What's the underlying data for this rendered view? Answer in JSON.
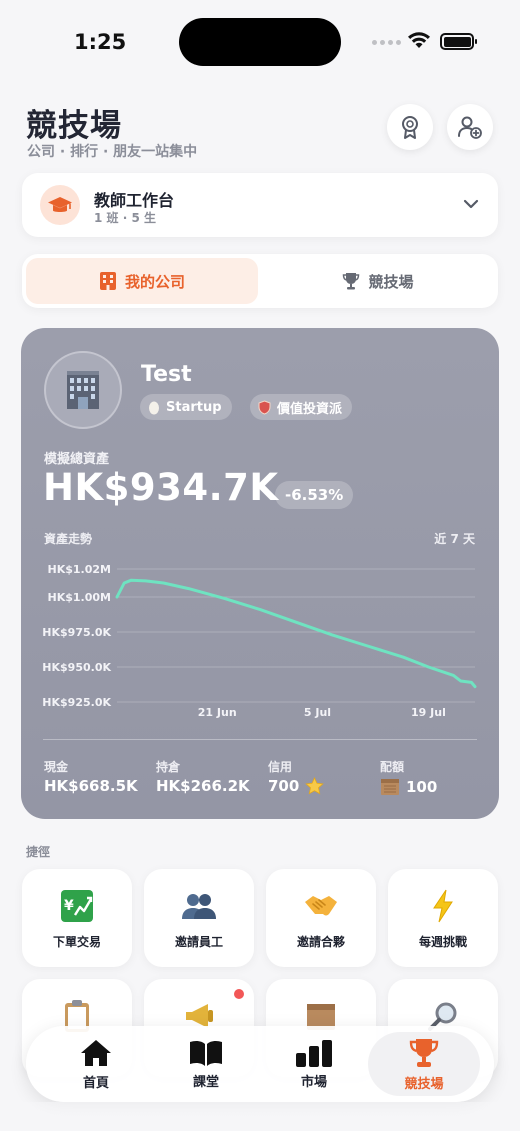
{
  "status_bar": {
    "time": "1:25"
  },
  "header": {
    "title": "競技場",
    "subtitle": "公司 · 排行 · 朋友一站集中",
    "buttons": [
      "badge-icon",
      "add-friend-icon"
    ]
  },
  "teacher": {
    "title": "教師工作台",
    "subtitle": "1 班 · 5 生",
    "icon": "graduation-cap-icon"
  },
  "segments": [
    {
      "label": "我的公司",
      "icon": "building-icon",
      "active": true
    },
    {
      "label": "競技場",
      "icon": "trophy-icon",
      "active": false
    }
  ],
  "company": {
    "name": "Test",
    "tags": [
      {
        "label": "Startup",
        "icon": "egg-icon"
      },
      {
        "label": "價值投資派",
        "icon": "shield-icon"
      }
    ],
    "assets_label": "模擬總資產",
    "assets_value": "HK$934.7K",
    "change": "-6.53%",
    "trend_label": "資產走勢",
    "range_label": "近 7 天",
    "stats": [
      {
        "label": "現金",
        "value": "HK$668.5K",
        "icon": ""
      },
      {
        "label": "持倉",
        "value": "HK$266.2K",
        "icon": ""
      },
      {
        "label": "信用",
        "value": "700",
        "icon": "star-icon"
      },
      {
        "label": "配額",
        "value": "100",
        "icon": "box-icon"
      }
    ]
  },
  "chart_data": {
    "type": "line",
    "y_tick_labels": [
      "HK$1.02M",
      "HK$1.00M",
      "HK$975.0K",
      "HK$950.0K",
      "HK$925.0K"
    ],
    "y_ticks": [
      1020000,
      1000000,
      975000,
      950000,
      925000
    ],
    "x_tick_labels": [
      "21 Jun",
      "5 Jul",
      "19 Jul"
    ],
    "ylim": [
      915000,
      1025000
    ],
    "grid": true,
    "series": [
      {
        "color": "#6fe3c1",
        "x": [
          0,
          0.02,
          0.04,
          0.08,
          0.13,
          0.2,
          0.3,
          0.4,
          0.5,
          0.6,
          0.7,
          0.8,
          0.87,
          0.94,
          0.96,
          0.99,
          1.0
        ],
        "values": [
          1000000,
          1010000,
          1012000,
          1011500,
          1010000,
          1006000,
          999000,
          991000,
          982000,
          973000,
          965000,
          957000,
          950000,
          944000,
          940000,
          939000,
          936000
        ]
      }
    ]
  },
  "shortcuts": {
    "title": "捷徑",
    "row1": [
      {
        "label": "下單交易",
        "icon": "chart-up-icon"
      },
      {
        "label": "邀請員工",
        "icon": "people-icon"
      },
      {
        "label": "邀請合夥",
        "icon": "handshake-icon"
      },
      {
        "label": "每週挑戰",
        "icon": "lightning-icon"
      }
    ],
    "row2": [
      {
        "label": "",
        "icon": "clipboard-icon"
      },
      {
        "label": "",
        "icon": "megaphone-icon",
        "badge": true
      },
      {
        "label": "",
        "icon": "box-icon"
      },
      {
        "label": "",
        "icon": "magnifier-icon"
      }
    ]
  },
  "tab_bar": [
    {
      "label": "首頁",
      "icon": "home-icon",
      "active": false
    },
    {
      "label": "課堂",
      "icon": "book-icon",
      "active": false
    },
    {
      "label": "市場",
      "icon": "bar-chart-icon",
      "active": false
    },
    {
      "label": "競技場",
      "icon": "trophy-icon",
      "active": true
    }
  ],
  "colors": {
    "accent": "#e8622c",
    "card_bg": "#9a9cab",
    "line": "#6fe3c1",
    "badge": "#f25757"
  }
}
